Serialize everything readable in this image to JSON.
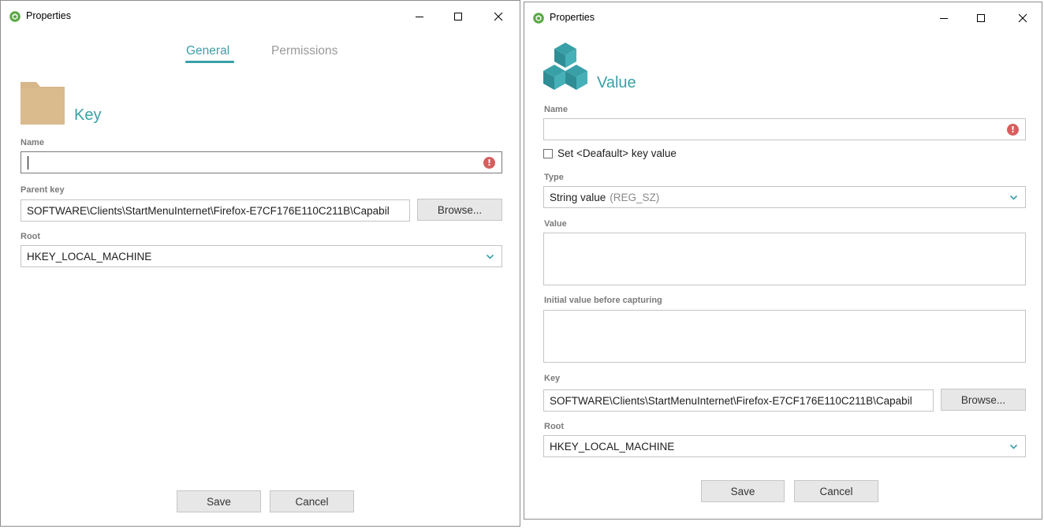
{
  "colors": {
    "accent": "#3aa0a8",
    "error": "#d75e5e",
    "folder": "#d7b78a",
    "label": "#7b7b7b"
  },
  "left": {
    "window_title": "Properties",
    "tabs": [
      {
        "label": "General",
        "active": true
      },
      {
        "label": "Permissions",
        "active": false
      }
    ],
    "heading": "Key",
    "name_label": "Name",
    "name_value": "",
    "parent_label": "Parent key",
    "parent_value": "SOFTWARE\\Clients\\StartMenuInternet\\Firefox-E7CF176E110C211B\\Capabil",
    "browse_label": "Browse...",
    "root_label": "Root",
    "root_value": "HKEY_LOCAL_MACHINE",
    "save_label": "Save",
    "cancel_label": "Cancel"
  },
  "right": {
    "window_title": "Properties",
    "heading": "Value",
    "name_label": "Name",
    "name_value": "",
    "default_checkbox_label": "Set <Deafault> key value",
    "default_checked": false,
    "type_label": "Type",
    "type_value": "String value",
    "type_hint": "(REG_SZ)",
    "value_label": "Value",
    "initial_label": "Initial value before capturing",
    "key_label": "Key",
    "key_value": "SOFTWARE\\Clients\\StartMenuInternet\\Firefox-E7CF176E110C211B\\Capabil",
    "browse_label": "Browse...",
    "root_label": "Root",
    "root_value": "HKEY_LOCAL_MACHINE",
    "save_label": "Save",
    "cancel_label": "Cancel"
  },
  "icons": {
    "app": "app-hexagon-icon",
    "minimize": "minimize-icon",
    "maximize": "maximize-icon",
    "close": "close-icon",
    "folder": "folder-icon",
    "cubes": "cubes-icon",
    "error": "error-icon",
    "chevron": "chevron-down-icon"
  }
}
